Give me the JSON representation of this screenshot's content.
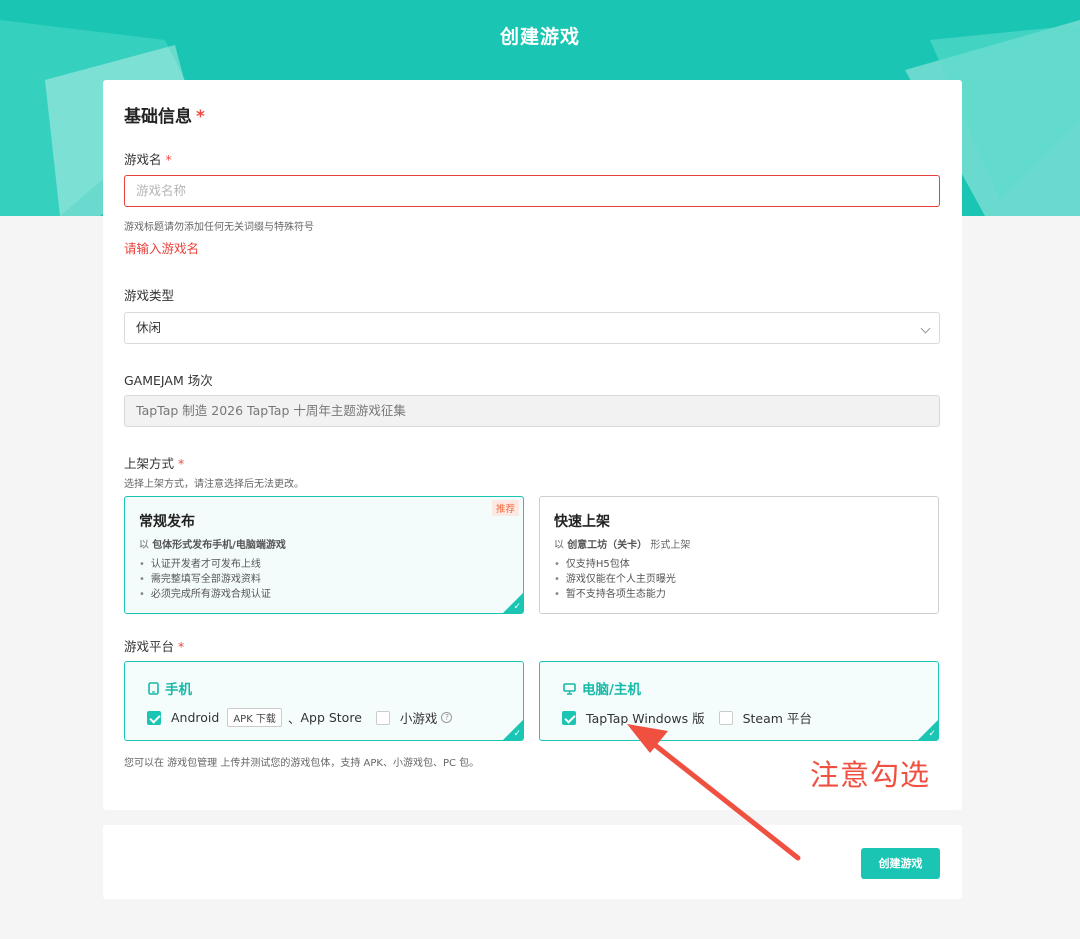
{
  "header": {
    "title": "创建游戏"
  },
  "basic": {
    "section_title": "基础信息",
    "required_mark": "*"
  },
  "game_name": {
    "label": "游戏名",
    "placeholder": "游戏名称",
    "hint": "游戏标题请勿添加任何无关词缀与特殊符号",
    "error": "请输入游戏名"
  },
  "game_type": {
    "label": "游戏类型",
    "value": "休闲"
  },
  "gamejam": {
    "label": "GAMEJAM 场次",
    "value": "TapTap 制造 2026 TapTap 十周年主题游戏征集"
  },
  "release": {
    "label": "上架方式",
    "hint": "选择上架方式，请注意选择后无法更改。",
    "options": [
      {
        "title": "常规发布",
        "desc_prefix": "以",
        "desc_bold": "包体形式发布手机/电脑端游戏",
        "desc_suffix": "",
        "badge": "推荐",
        "bullets": [
          "认证开发者才可发布上线",
          "需完整填写全部游戏资料",
          "必须完成所有游戏合规认证"
        ],
        "selected": true
      },
      {
        "title": "快速上架",
        "desc_prefix": "以",
        "desc_bold": "创意工坊（关卡）",
        "desc_suffix": "形式上架",
        "bullets": [
          "仅支持H5包体",
          "游戏仅能在个人主页曝光",
          "暂不支持各项生态能力"
        ],
        "selected": false
      }
    ]
  },
  "platform": {
    "label": "游戏平台",
    "mobile": {
      "title": "手机",
      "android": "Android",
      "apk_tag": "APK 下载",
      "separator": "、",
      "appstore": "App Store",
      "minigame": "小游戏",
      "help": "?"
    },
    "pc": {
      "title": "电脑/主机",
      "taptap": "TapTap Windows 版",
      "steam": "Steam 平台"
    },
    "note": "您可以在 游戏包管理 上传并测试您的游戏包体，支持 APK、小游戏包、PC 包。"
  },
  "footer": {
    "create_button": "创建游戏"
  },
  "annotation": {
    "text": "注意勾选"
  },
  "colors": {
    "accent": "#1ac6b3",
    "error": "#e8413b",
    "annotation": "#f05040"
  }
}
